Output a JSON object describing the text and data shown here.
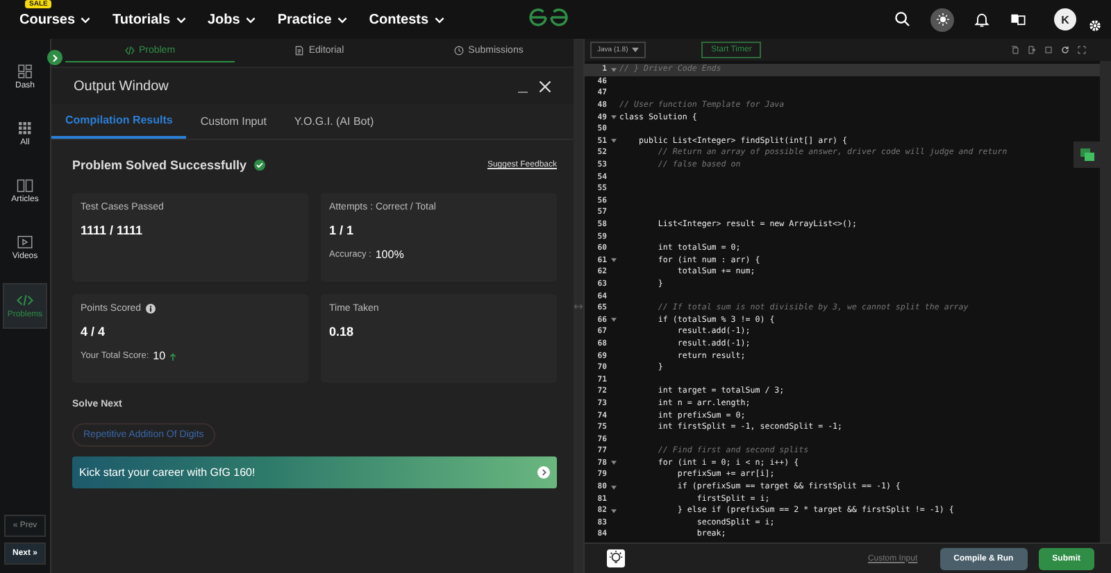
{
  "topnav": {
    "sale_badge": "SALE",
    "items": [
      {
        "label": "Courses"
      },
      {
        "label": "Tutorials"
      },
      {
        "label": "Jobs"
      },
      {
        "label": "Practice"
      },
      {
        "label": "Contests"
      }
    ],
    "avatar": "K"
  },
  "sidebar": {
    "items": [
      {
        "label": "Dash",
        "selected": false
      },
      {
        "label": "All",
        "selected": false
      },
      {
        "label": "Articles",
        "selected": false
      },
      {
        "label": "Videos",
        "selected": false
      },
      {
        "label": "Problems",
        "selected": true
      }
    ],
    "prev": "« Prev",
    "next": "Next »"
  },
  "problem_tabs": [
    {
      "label": "Problem",
      "selected": true
    },
    {
      "label": "Editorial",
      "selected": false
    },
    {
      "label": "Submissions",
      "selected": false
    }
  ],
  "output_window": {
    "title": "Output Window",
    "tabs": [
      {
        "label": "Compilation Results",
        "selected": true
      },
      {
        "label": "Custom Input",
        "selected": false
      },
      {
        "label": "Y.O.G.I. (AI Bot)",
        "selected": false
      }
    ],
    "status": "Problem Solved Successfully",
    "feedback": "Suggest Feedback",
    "cards": [
      {
        "title": "Test Cases Passed",
        "value": "1111 / 1111"
      },
      {
        "title": "Attempts : Correct / Total",
        "value": "1 / 1",
        "note_label": "Accuracy :",
        "note_value": "100%"
      },
      {
        "title": "Points Scored",
        "info": true,
        "value": "4 / 4",
        "note_label": "Your Total Score:",
        "note_value": "10",
        "trend_up": true
      },
      {
        "title": "Time Taken",
        "value": "0.18"
      }
    ],
    "solve_next": {
      "heading": "Solve Next",
      "chips": [
        "Repetitive Addition Of Digits"
      ]
    },
    "banner": "Kick start your career with GfG 160!"
  },
  "editor": {
    "language": "Java (1.8)",
    "timer": "Start Timer",
    "lines": [
      {
        "num": "1",
        "text": "// } Driver Code Ends",
        "kind": "comment",
        "fold": true,
        "current": true
      },
      {
        "num": "46",
        "fold": false,
        "current": false
      },
      {
        "num": "47",
        "fold": false,
        "current": false
      },
      {
        "num": "48",
        "text": "// User function Template for Java",
        "kind": "comment",
        "fold": false,
        "current": false
      },
      {
        "num": "49",
        "text": "class Solution {",
        "kind": "code",
        "fold": true,
        "current": false
      },
      {
        "num": "50",
        "fold": false,
        "current": false
      },
      {
        "num": "51",
        "text": "    public List<Integer> findSplit(int[] arr) {",
        "kind": "code",
        "fold": true,
        "current": false
      },
      {
        "num": "52",
        "text": "        // Return an array of possible answer, driver code will judge and return",
        "kind": "comment",
        "fold": false,
        "current": false
      },
      {
        "num": "53",
        "text": "        // false based on",
        "kind": "comment",
        "fold": false,
        "current": false
      },
      {
        "num": "54",
        "fold": false,
        "current": false
      },
      {
        "num": "55",
        "fold": false,
        "current": false
      },
      {
        "num": "56",
        "fold": false,
        "current": false
      },
      {
        "num": "57",
        "fold": false,
        "current": false
      },
      {
        "num": "58",
        "text": "        List<Integer> result = new ArrayList<>();",
        "kind": "code",
        "fold": false,
        "current": false
      },
      {
        "num": "59",
        "fold": false,
        "current": false
      },
      {
        "num": "60",
        "text": "        int totalSum = 0;",
        "kind": "code",
        "fold": false,
        "current": false
      },
      {
        "num": "61",
        "text": "        for (int num : arr) {",
        "kind": "code",
        "fold": true,
        "current": false
      },
      {
        "num": "62",
        "text": "            totalSum += num;",
        "kind": "code",
        "fold": false,
        "current": false
      },
      {
        "num": "63",
        "text": "        }",
        "kind": "code",
        "fold": false,
        "current": false
      },
      {
        "num": "64",
        "fold": false,
        "current": false
      },
      {
        "num": "65",
        "text": "        // If total sum is not divisible by 3, we cannot split the array",
        "kind": "comment",
        "fold": false,
        "current": false
      },
      {
        "num": "66",
        "text": "        if (totalSum % 3 != 0) {",
        "kind": "code",
        "fold": true,
        "current": false
      },
      {
        "num": "67",
        "text": "            result.add(-1);",
        "kind": "code",
        "fold": false,
        "current": false
      },
      {
        "num": "68",
        "text": "            result.add(-1);",
        "kind": "code",
        "fold": false,
        "current": false
      },
      {
        "num": "69",
        "text": "            return result;",
        "kind": "code",
        "fold": false,
        "current": false
      },
      {
        "num": "70",
        "text": "        }",
        "kind": "code",
        "fold": false,
        "current": false
      },
      {
        "num": "71",
        "fold": false,
        "current": false
      },
      {
        "num": "72",
        "text": "        int target = totalSum / 3;",
        "kind": "code",
        "fold": false,
        "current": false
      },
      {
        "num": "73",
        "text": "        int n = arr.length;",
        "kind": "code",
        "fold": false,
        "current": false
      },
      {
        "num": "74",
        "text": "        int prefixSum = 0;",
        "kind": "code",
        "fold": false,
        "current": false
      },
      {
        "num": "75",
        "text": "        int firstSplit = -1, secondSplit = -1;",
        "kind": "code",
        "fold": false,
        "current": false
      },
      {
        "num": "76",
        "fold": false,
        "current": false
      },
      {
        "num": "77",
        "text": "        // Find first and second splits",
        "kind": "comment",
        "fold": false,
        "current": false
      },
      {
        "num": "78",
        "text": "        for (int i = 0; i < n; i++) {",
        "kind": "code",
        "fold": true,
        "current": false
      },
      {
        "num": "79",
        "text": "            prefixSum += arr[i];",
        "kind": "code",
        "fold": false,
        "current": false
      },
      {
        "num": "80",
        "text": "            if (prefixSum == target && firstSplit == -1) {",
        "kind": "code",
        "fold": true,
        "current": false
      },
      {
        "num": "81",
        "text": "                firstSplit = i;",
        "kind": "code",
        "fold": false,
        "current": false
      },
      {
        "num": "82",
        "text": "            } else if (prefixSum == 2 * target && firstSplit != -1) {",
        "kind": "code",
        "fold": true,
        "current": false
      },
      {
        "num": "83",
        "text": "                secondSplit = i;",
        "kind": "code",
        "fold": false,
        "current": false
      },
      {
        "num": "84",
        "text": "                break;",
        "kind": "code",
        "fold": false,
        "current": false
      }
    ],
    "custom_input": "Custom Input",
    "compile": "Compile & Run",
    "submit": "Submit"
  }
}
